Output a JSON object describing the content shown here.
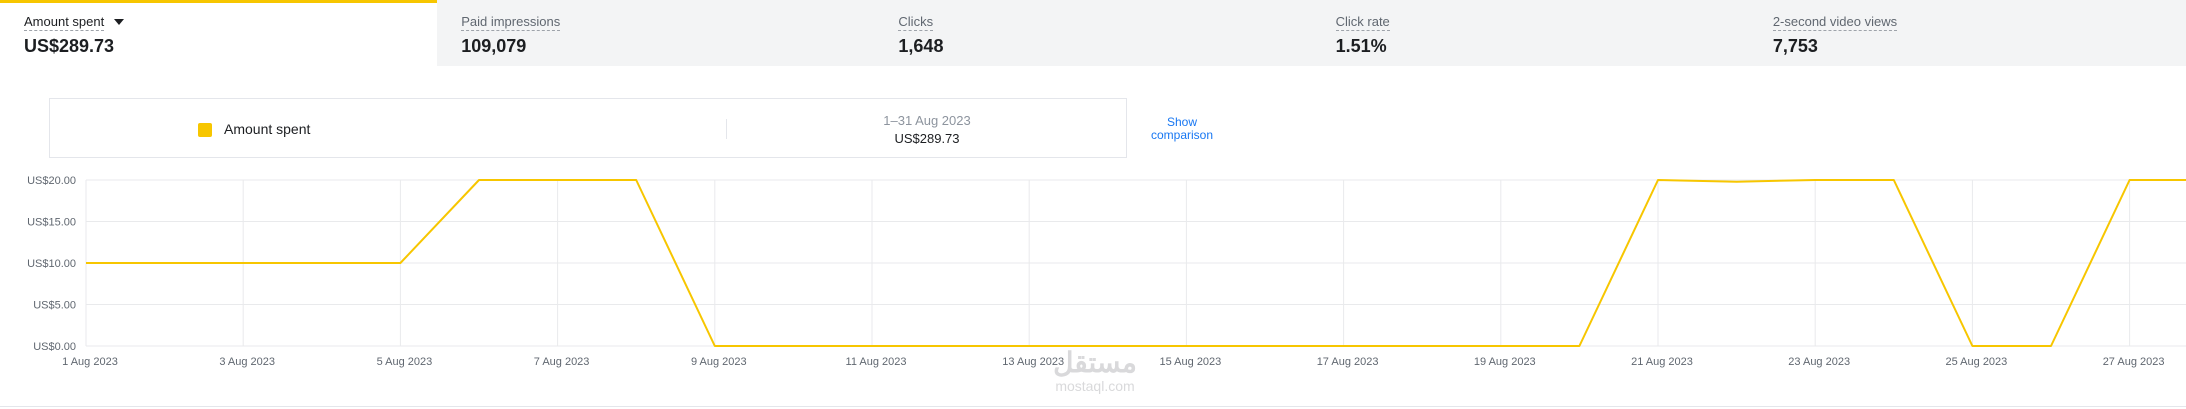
{
  "metrics": [
    {
      "label": "Amount spent",
      "value": "US$289.73",
      "active": true
    },
    {
      "label": "Paid impressions",
      "value": "109,079"
    },
    {
      "label": "Clicks",
      "value": "1,648"
    },
    {
      "label": "Click rate",
      "value": "1.51%"
    },
    {
      "label": "2-second video views",
      "value": "7,753"
    }
  ],
  "legend": {
    "series_name": "Amount spent",
    "date_range": "1–31 Aug 2023",
    "total": "US$289.73",
    "show_comparison": "Show comparison"
  },
  "colors": {
    "series": "#f7c600",
    "accent": "#f7c600",
    "link": "#1877f2"
  },
  "watermark": {
    "arabic": "مستقل",
    "latin": "mostaql.com"
  },
  "chart_data": {
    "type": "line",
    "ylim": [
      0,
      20
    ],
    "y_ticks": [
      {
        "value": 0,
        "label": "US$0.00"
      },
      {
        "value": 5,
        "label": "US$5.00"
      },
      {
        "value": 10,
        "label": "US$10.00"
      },
      {
        "value": 15,
        "label": "US$15.00"
      },
      {
        "value": 20,
        "label": "US$20.00"
      }
    ],
    "x_ticks": [
      "1 Aug 2023",
      "3 Aug 2023",
      "5 Aug 2023",
      "7 Aug 2023",
      "9 Aug 2023",
      "11 Aug 2023",
      "13 Aug 2023",
      "15 Aug 2023",
      "17 Aug 2023",
      "19 Aug 2023",
      "21 Aug 2023",
      "23 Aug 2023",
      "25 Aug 2023",
      "27 Aug 2023"
    ],
    "grid": true,
    "series": [
      {
        "name": "Amount spent",
        "x": [
          "1 Aug 2023",
          "2 Aug 2023",
          "3 Aug 2023",
          "4 Aug 2023",
          "5 Aug 2023",
          "6 Aug 2023",
          "7 Aug 2023",
          "8 Aug 2023",
          "9 Aug 2023",
          "10 Aug 2023",
          "11 Aug 2023",
          "12 Aug 2023",
          "13 Aug 2023",
          "14 Aug 2023",
          "15 Aug 2023",
          "16 Aug 2023",
          "17 Aug 2023",
          "18 Aug 2023",
          "19 Aug 2023",
          "20 Aug 2023",
          "21 Aug 2023",
          "22 Aug 2023",
          "23 Aug 2023",
          "24 Aug 2023",
          "25 Aug 2023",
          "26 Aug 2023",
          "27 Aug 2023",
          "28 Aug 2023"
        ],
        "values": [
          10,
          10,
          10,
          10,
          10,
          20,
          20,
          20,
          0,
          0,
          0,
          0,
          0,
          0,
          0,
          0,
          0,
          0,
          0,
          0,
          20,
          19.8,
          20,
          20,
          0,
          0,
          20,
          20
        ]
      }
    ]
  }
}
